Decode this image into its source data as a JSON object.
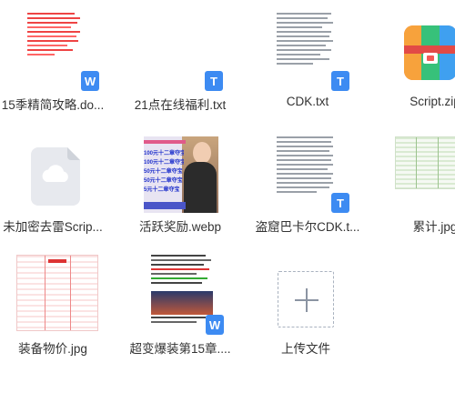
{
  "files": [
    {
      "name": "15季精简攻略.do...",
      "type_badge": "W",
      "thumb": "doc-red"
    },
    {
      "name": "21点在线福利.txt",
      "type_badge": "T",
      "thumb": "txt-blank"
    },
    {
      "name": "CDK.txt",
      "type_badge": "T",
      "thumb": "txt-lines"
    },
    {
      "name": "Script.zip",
      "type_badge": "",
      "thumb": "zip-icon"
    },
    {
      "name": "未加密去雷Scrip...",
      "type_badge": "",
      "thumb": "cloud-file"
    },
    {
      "name": "活跃奖励.webp",
      "type_badge": "",
      "thumb": "promo-image"
    },
    {
      "name": "盗窟巴卡尔CDK.t...",
      "type_badge": "T",
      "thumb": "txt-lines"
    },
    {
      "name": "累计.jpg",
      "type_badge": "",
      "thumb": "green-table"
    },
    {
      "name": "装备物价.jpg",
      "type_badge": "",
      "thumb": "red-table"
    },
    {
      "name": "超变爆装第15章....",
      "type_badge": "W",
      "thumb": "doc-game"
    }
  ],
  "upload": {
    "label": "上传文件"
  },
  "promo": {
    "rows": [
      "100元十二章夺宝",
      "100元十二章夺宝",
      "50元十二章夺宝",
      "50元十二章夺宝",
      "5元十二章夺宝"
    ]
  },
  "colors": {
    "badge_blue": "#3d8bf2",
    "zip_red": "#f25b57",
    "zip_green": "#37c17a",
    "zip_orange": "#f7a23c",
    "zip_blue": "#3fa0f0"
  }
}
